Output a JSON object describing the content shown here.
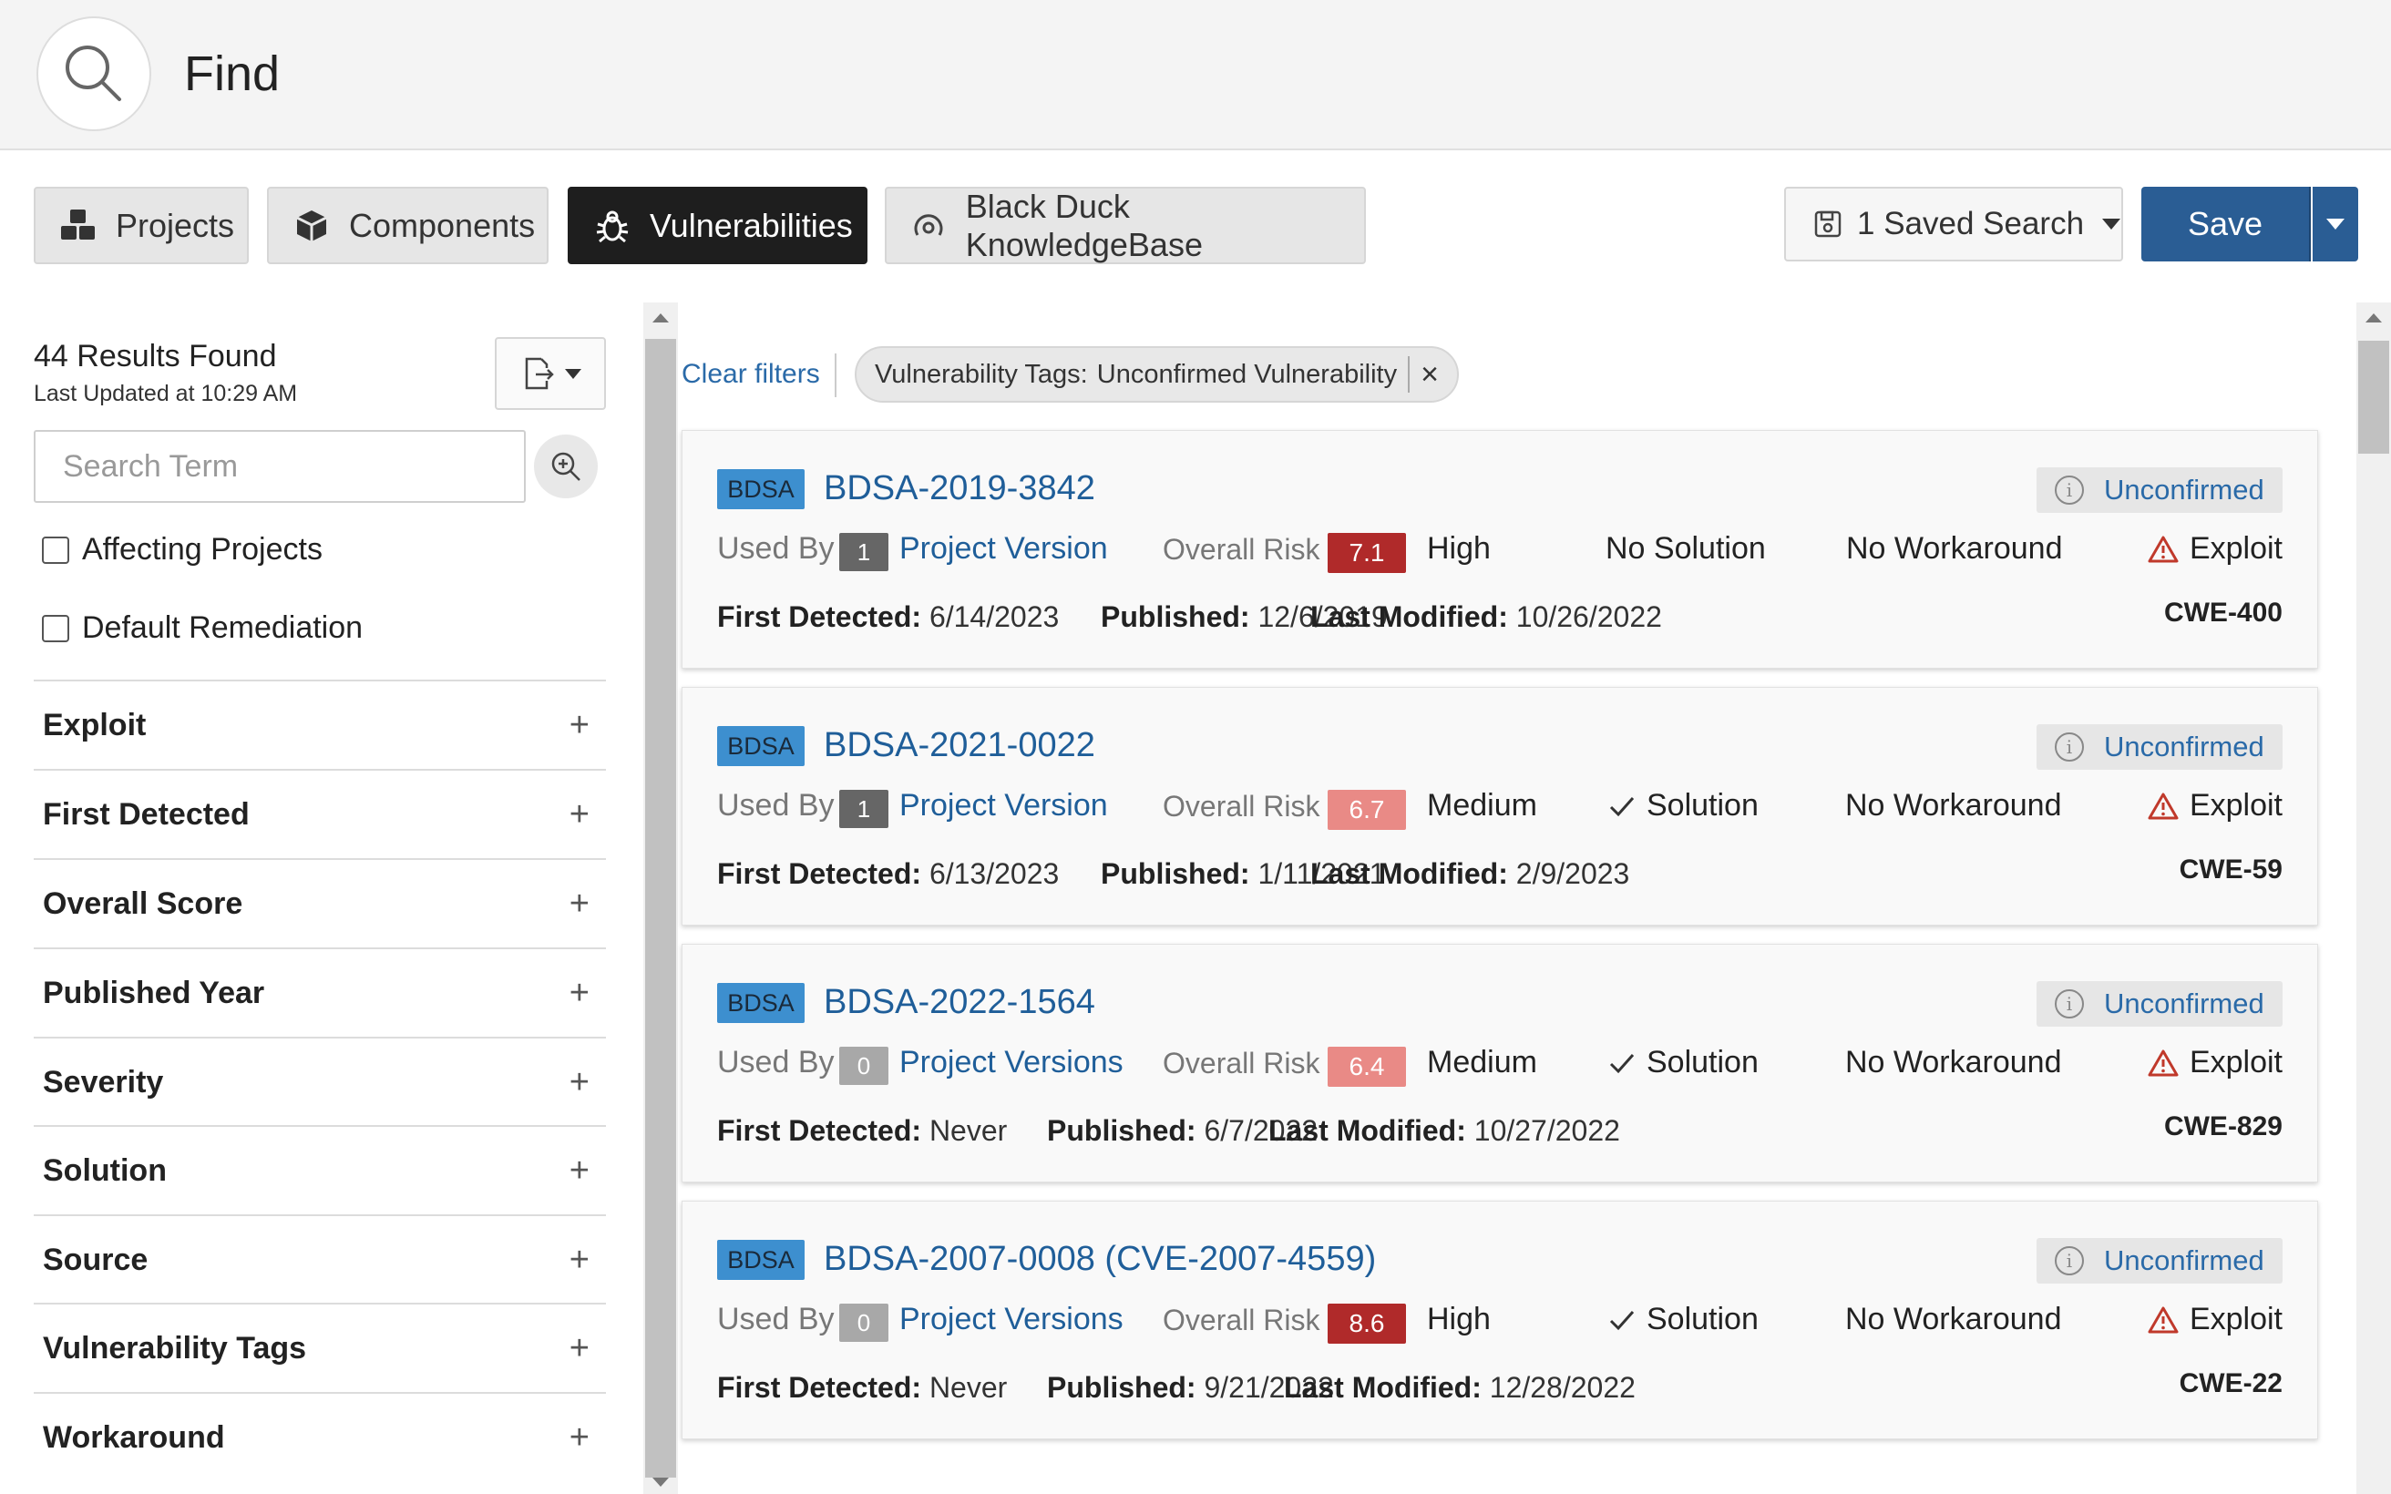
{
  "header": {
    "title": "Find"
  },
  "tabs": [
    {
      "label": "Projects",
      "icon": "cubes-icon"
    },
    {
      "label": "Components",
      "icon": "cube-icon"
    },
    {
      "label": "Vulnerabilities",
      "icon": "bug-icon",
      "active": true
    },
    {
      "label": "Black Duck KnowledgeBase",
      "icon": "knowledgebase-icon"
    }
  ],
  "toolbar": {
    "saved_search_label": "1 Saved Search",
    "save_label": "Save"
  },
  "sidebar": {
    "results_count": "44 Results Found",
    "last_updated": "Last Updated at 10:29 AM",
    "search_placeholder": "Search Term",
    "checkboxes": [
      {
        "label": "Affecting Projects",
        "checked": false
      },
      {
        "label": "Default Remediation",
        "checked": false
      }
    ],
    "facets": [
      "Exploit",
      "First Detected",
      "Overall Score",
      "Published Year",
      "Severity",
      "Solution",
      "Source",
      "Vulnerability Tags",
      "Workaround"
    ],
    "facet_expand_symbol": "+"
  },
  "filters": {
    "clear_label": "Clear filters",
    "chips": [
      {
        "name": "Vulnerability Tags:",
        "value": "Unconfirmed Vulnerability",
        "remove_symbol": "×"
      }
    ]
  },
  "labels": {
    "used_by": "Used By",
    "overall_risk": "Overall Risk",
    "first_detected": "First Detected:",
    "published": "Published:",
    "last_modified": "Last Modified:",
    "exploit": "Exploit",
    "source_badge": "BDSA"
  },
  "vulnerabilities": [
    {
      "id": "BDSA-2019-3842",
      "tag": "Unconfirmed",
      "used_by_count": "1",
      "used_by_label": "Project Version",
      "risk_score": "7.1",
      "risk_level": "High",
      "risk_color": "#b02a2a",
      "count_color": "#666666",
      "solution": "No Solution",
      "solution_check": false,
      "workaround": "No Workaround",
      "first_detected": "6/14/2023",
      "published": "12/6/2019",
      "last_modified": "10/26/2022",
      "cwe": "CWE-400"
    },
    {
      "id": "BDSA-2021-0022",
      "tag": "Unconfirmed",
      "used_by_count": "1",
      "used_by_label": "Project Version",
      "risk_score": "6.7",
      "risk_level": "Medium",
      "risk_color": "#e98a86",
      "count_color": "#666666",
      "solution": "Solution",
      "solution_check": true,
      "workaround": "No Workaround",
      "first_detected": "6/13/2023",
      "published": "1/11/2021",
      "last_modified": "2/9/2023",
      "cwe": "CWE-59"
    },
    {
      "id": "BDSA-2022-1564",
      "tag": "Unconfirmed",
      "used_by_count": "0",
      "used_by_label": "Project Versions",
      "risk_score": "6.4",
      "risk_level": "Medium",
      "risk_color": "#e98a86",
      "count_color": "#a8a8a8",
      "solution": "Solution",
      "solution_check": true,
      "workaround": "No Workaround",
      "first_detected": "Never",
      "published": "6/7/2022",
      "last_modified": "10/27/2022",
      "cwe": "CWE-829"
    },
    {
      "id": "BDSA-2007-0008  (CVE-2007-4559)",
      "tag": "Unconfirmed",
      "used_by_count": "0",
      "used_by_label": "Project Versions",
      "risk_score": "8.6",
      "risk_level": "High",
      "risk_color": "#b02a2a",
      "count_color": "#a8a8a8",
      "solution": "Solution",
      "solution_check": true,
      "workaround": "No Workaround",
      "first_detected": "Never",
      "published": "9/21/2022",
      "last_modified": "12/28/2022",
      "cwe": "CWE-22"
    }
  ]
}
